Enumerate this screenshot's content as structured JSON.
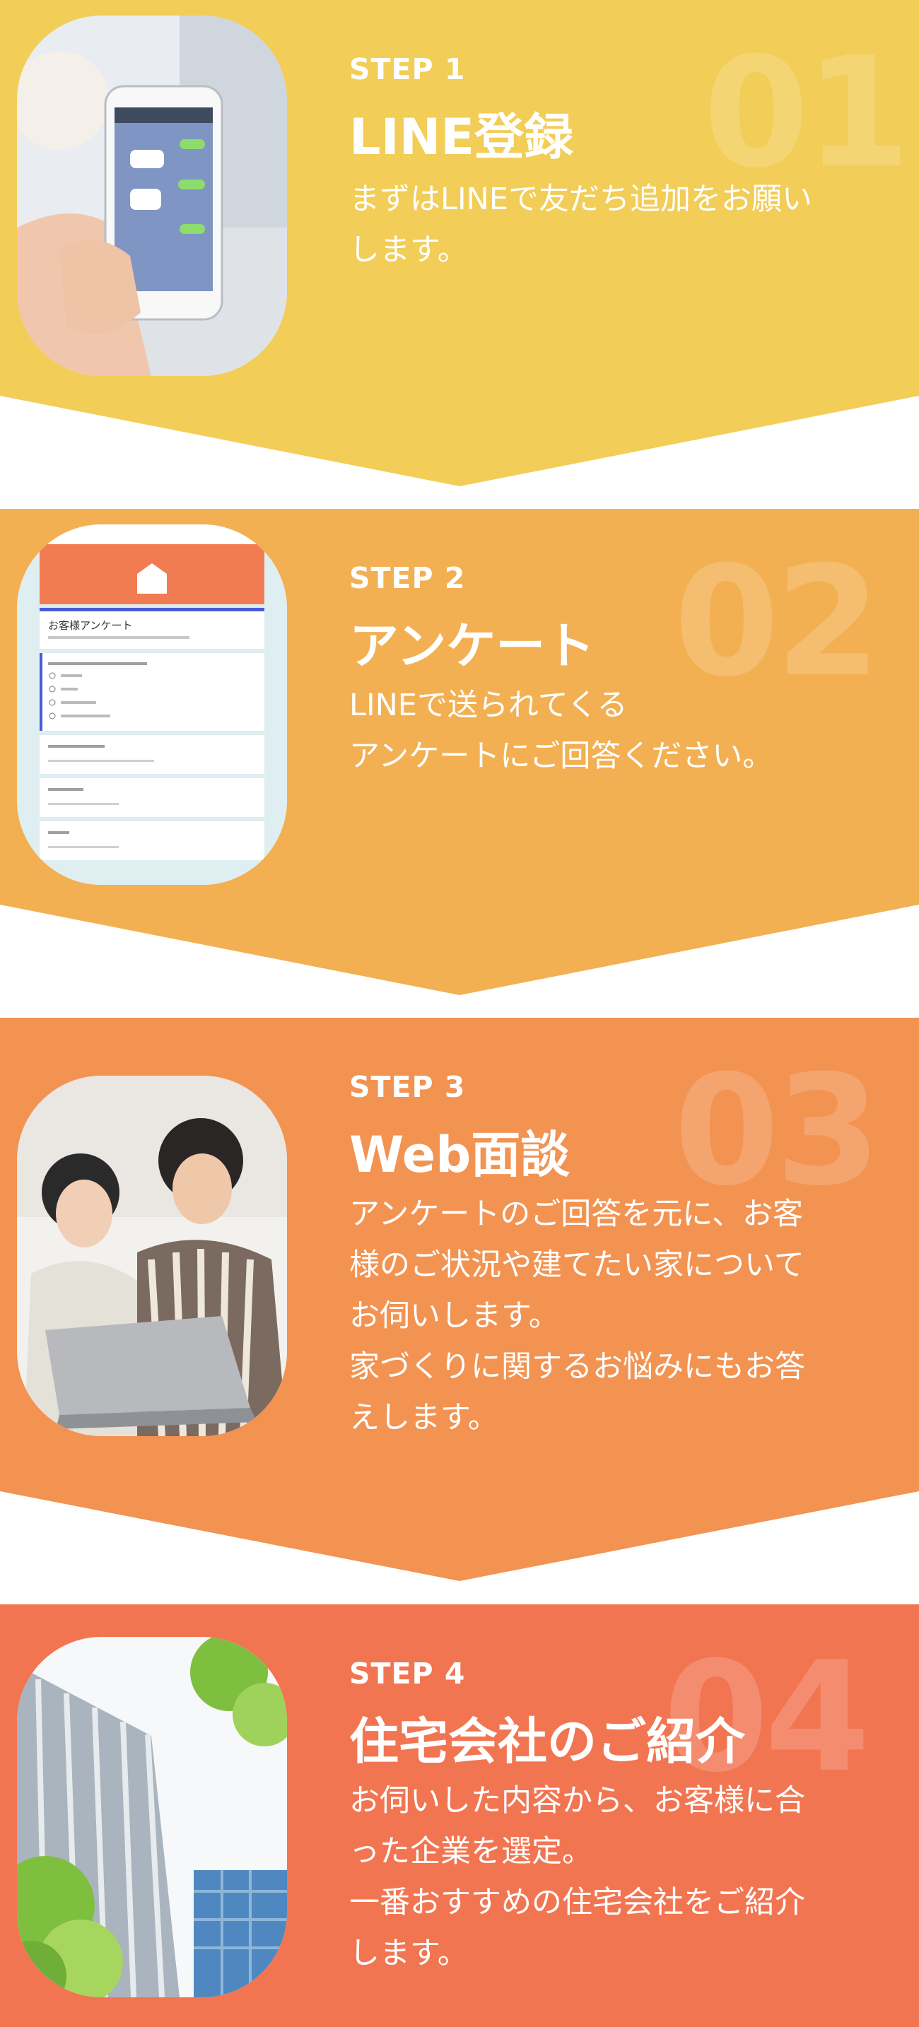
{
  "colors": {
    "step1": "#F2CD57",
    "step2": "#F2B052",
    "step3": "#F29352",
    "step4": "#F27552"
  },
  "steps": [
    {
      "label": "STEP 1",
      "number": "01",
      "title": "LINE登録",
      "desc": [
        "まずはLINEで友だち追加をお願い",
        "します。"
      ],
      "image": "smartphone-line-chat-photo"
    },
    {
      "label": "STEP 2",
      "number": "02",
      "title": "アンケート",
      "desc": [
        "LINEで送られてくる",
        "アンケートにご回答ください。"
      ],
      "image": "survey-form-screenshot",
      "survey": {
        "heading": "お客様アンケート"
      }
    },
    {
      "label": "STEP 3",
      "number": "03",
      "title": "Web面談",
      "desc": [
        "アンケートのご回答を元に、お客",
        "様のご状況や建てたい家について",
        "お伺いします。",
        "家づくりに関するお悩みにもお答",
        "えします。"
      ],
      "image": "couple-laptop-photo"
    },
    {
      "label": "STEP 4",
      "number": "04",
      "title": "住宅会社のご紹介",
      "desc": [
        "お伺いした内容から、お客様に合",
        "った企業を選定。",
        "一番おすすめの住宅会社をご紹介",
        "します。"
      ],
      "image": "office-building-photo"
    }
  ]
}
